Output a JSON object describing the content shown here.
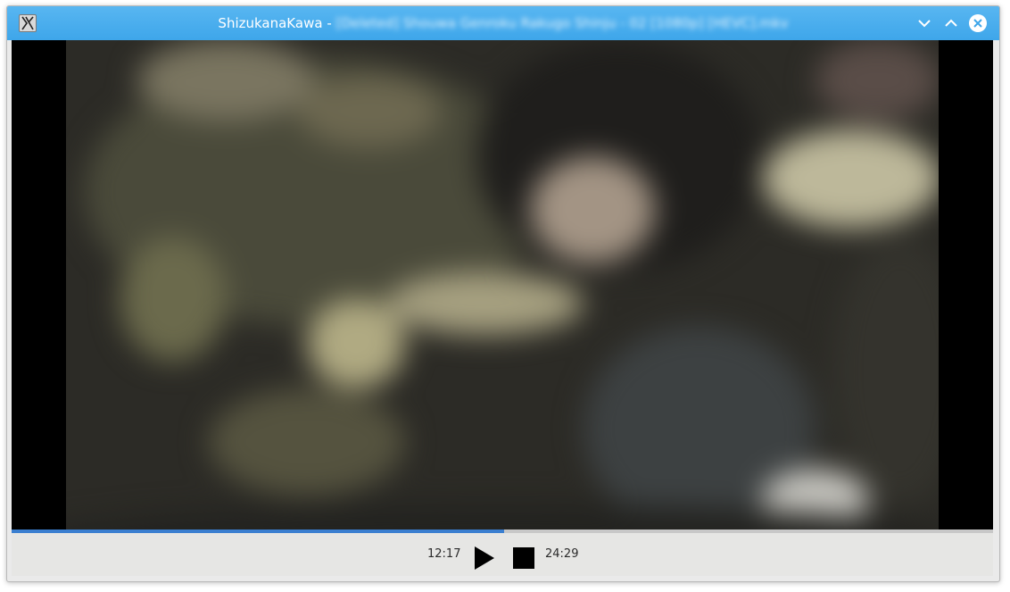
{
  "window": {
    "app_name": "ShizukanaKawa",
    "title_separator": " - ",
    "file_name": "[Deleted] Shouwa Genroku Rakugo Shinju - 02 [1080p] [HEVC].mkv"
  },
  "titlebar": {
    "app_icon": "x-app-icon",
    "buttons": [
      {
        "name": "minimize",
        "icon": "chevron-down-icon"
      },
      {
        "name": "maximize",
        "icon": "chevron-up-icon"
      },
      {
        "name": "close",
        "icon": "close-circle-icon"
      }
    ]
  },
  "player": {
    "current_time": "12:17",
    "total_time": "24:29",
    "progress_fraction": 0.502,
    "play_icon": "play-icon",
    "stop_icon": "stop-icon",
    "accent_color": "#3b7fd0",
    "titlebar_color": "#4aaeee"
  }
}
